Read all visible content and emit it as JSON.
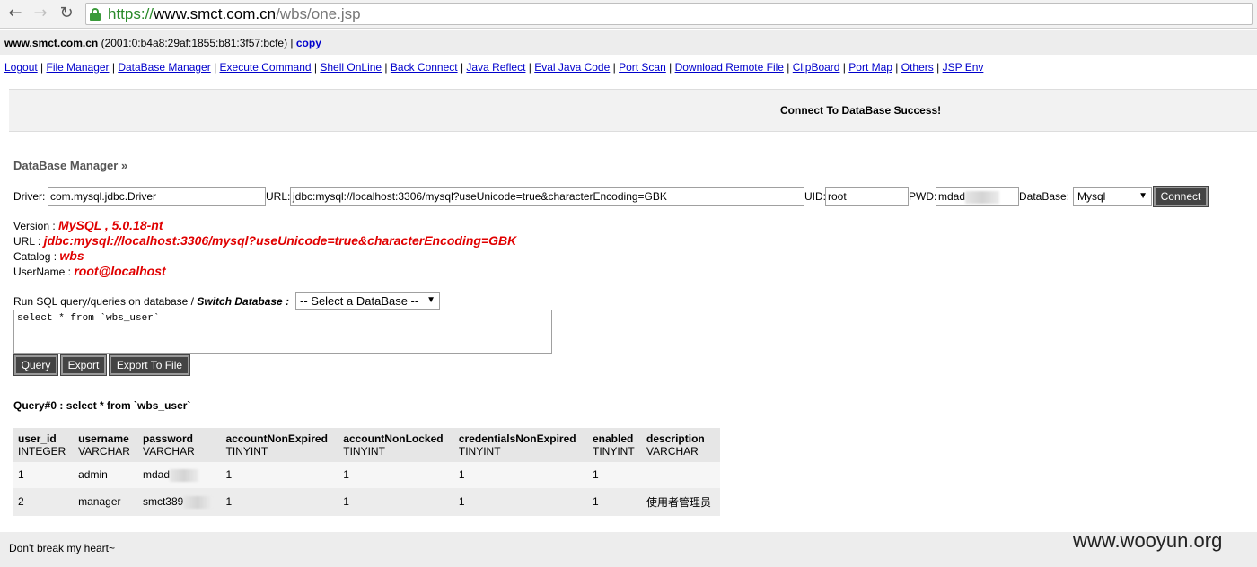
{
  "browser": {
    "url_scheme": "https://",
    "url_host": "www.smct.com.cn",
    "url_path": "/wbs/one.jsp",
    "back_icon": "←",
    "forward_icon": "→",
    "reload_icon": "↻"
  },
  "info": {
    "host": "www.smct.com.cn",
    "ip": " (2001:0:b4a8:29af:1855:b81:3f57:bcfe) | ",
    "copy": "copy"
  },
  "menu": [
    "Logout",
    "File Manager",
    "DataBase Manager",
    "Execute Command",
    "Shell OnLine",
    "Back Connect",
    "Java Reflect",
    "Eval Java Code",
    "Port Scan",
    "Download Remote File",
    "ClipBoard",
    "Port Map",
    "Others",
    "JSP Env"
  ],
  "success_msg": "Connect To DataBase Success!",
  "section_title": "DataBase Manager »",
  "form": {
    "driver_label": "Driver:",
    "driver_value": "com.mysql.jdbc.Driver",
    "url_label": "URL:",
    "url_value": "jdbc:mysql://localhost:3306/mysql?useUnicode=true&characterEncoding=GBK",
    "uid_label": "UID:",
    "uid_value": "root",
    "pwd_label": "PWD:",
    "pwd_value": "mdad",
    "db_label": "DataBase:",
    "db_value": "Mysql",
    "connect": "Connect"
  },
  "dbinfo": {
    "version_label": "Version : ",
    "version": "MySQL , 5.0.18-nt",
    "url_label": "URL : ",
    "url": "jdbc:mysql://localhost:3306/mysql?useUnicode=true&characterEncoding=GBK",
    "catalog_label": "Catalog : ",
    "catalog": "wbs",
    "username_label": "UserName : ",
    "username": "root@localhost"
  },
  "sql": {
    "prompt": "Run SQL query/queries on database / ",
    "switch": "Switch Database :",
    "select_db": "-- Select a DataBase --",
    "query_text": "select * from `wbs_user`",
    "query_btn": "Query",
    "export_btn": "Export",
    "export_file_btn": "Export To File"
  },
  "result": {
    "title": "Query#0 : select * from `wbs_user`",
    "columns": [
      {
        "name": "user_id",
        "type": "INTEGER"
      },
      {
        "name": "username",
        "type": "VARCHAR"
      },
      {
        "name": "password",
        "type": "VARCHAR"
      },
      {
        "name": "accountNonExpired",
        "type": "TINYINT"
      },
      {
        "name": "accountNonLocked",
        "type": "TINYINT"
      },
      {
        "name": "credentialsNonExpired",
        "type": "TINYINT"
      },
      {
        "name": "enabled",
        "type": "TINYINT"
      },
      {
        "name": "description",
        "type": "VARCHAR"
      }
    ],
    "rows": [
      [
        "1",
        "admin",
        "mdad",
        "1",
        "1",
        "1",
        "1",
        ""
      ],
      [
        "2",
        "manager",
        "smct389",
        "1",
        "1",
        "1",
        "1",
        "使用者管理员"
      ]
    ]
  },
  "footer": "Don't break my heart~",
  "watermark": "www.wooyun.org"
}
